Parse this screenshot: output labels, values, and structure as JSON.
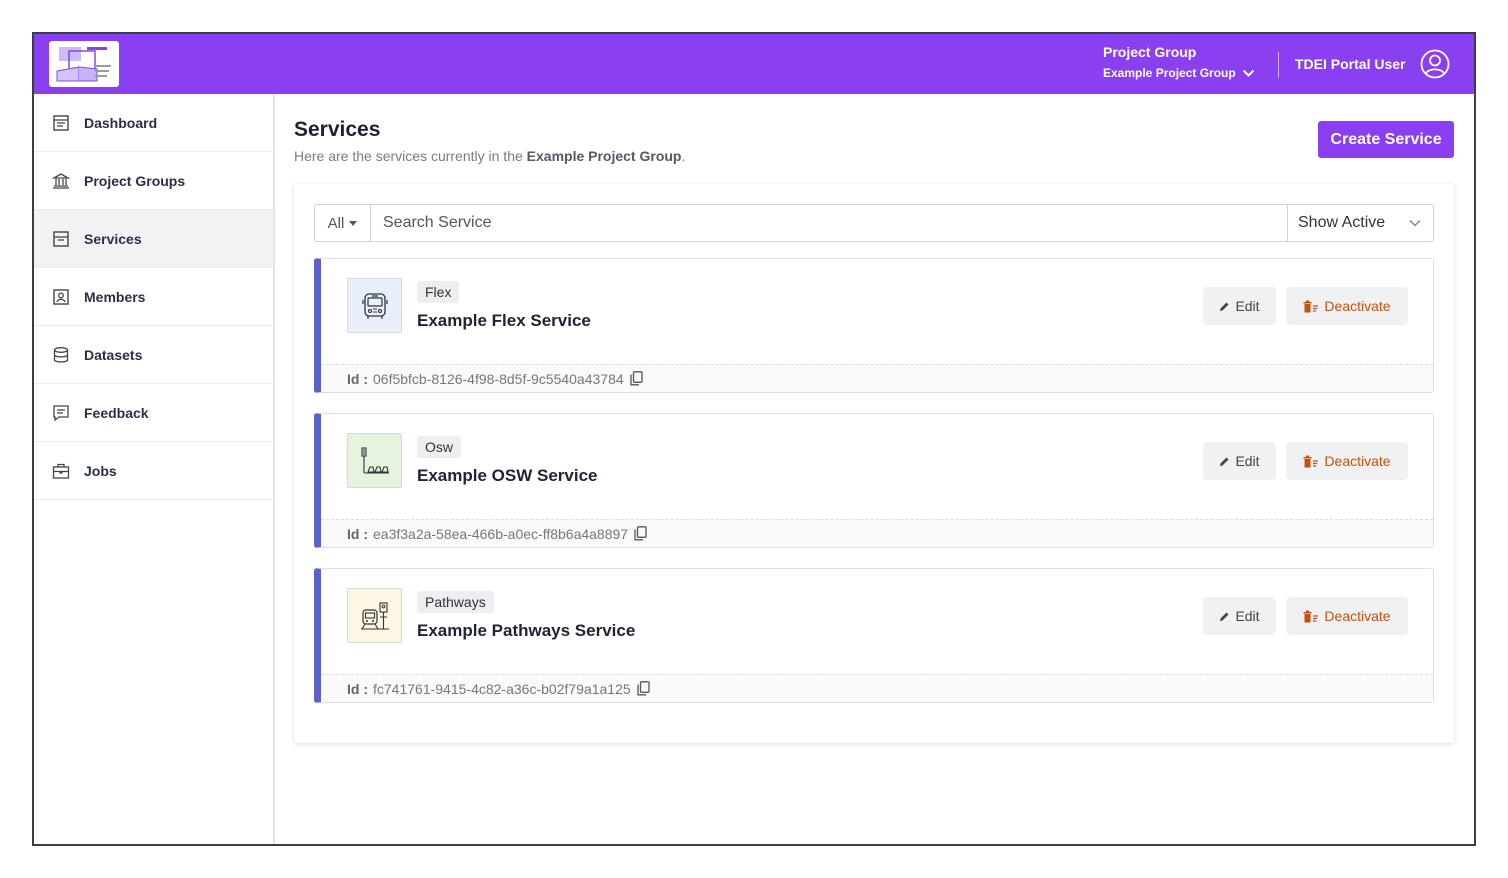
{
  "header": {
    "project_group_label": "Project Group",
    "project_group_value": "Example Project Group",
    "user_name": "TDEI Portal User"
  },
  "sidebar": {
    "items": [
      {
        "label": "Dashboard",
        "icon": "dashboard-icon"
      },
      {
        "label": "Project Groups",
        "icon": "bank-icon"
      },
      {
        "label": "Services",
        "icon": "archive-icon",
        "active": true
      },
      {
        "label": "Members",
        "icon": "member-badge-icon"
      },
      {
        "label": "Datasets",
        "icon": "database-icon"
      },
      {
        "label": "Feedback",
        "icon": "feedback-icon"
      },
      {
        "label": "Jobs",
        "icon": "briefcase-icon"
      }
    ]
  },
  "main": {
    "title": "Services",
    "subtitle_prefix": "Here are the services currently in the",
    "subtitle_group": "Example Project Group",
    "subtitle_suffix": ".",
    "create_label": "Create Service",
    "filter_all": "All",
    "search_placeholder": "Search Service",
    "status_filter": "Show Active",
    "edit_label": "Edit",
    "deactivate_label": "Deactivate",
    "id_label": "Id :",
    "services": [
      {
        "type": "Flex",
        "name": "Example Flex Service",
        "id": "06f5bfcb-8126-4f98-8d5f-9c5540a43784",
        "icon": "bus-icon",
        "icon_bg": "#e8f1fb"
      },
      {
        "type": "Osw",
        "name": "Example OSW Service",
        "id": "ea3f3a2a-58ea-466b-a0ec-ff8b6a4a8897",
        "icon": "sidewalk-icon",
        "icon_bg": "#e6f4df"
      },
      {
        "type": "Pathways",
        "name": "Example Pathways Service",
        "id": "fc741761-9415-4c82-a36c-b02f79a1a125",
        "icon": "train-station-icon",
        "icon_bg": "#fdf6e2"
      }
    ]
  },
  "colors": {
    "brand": "#8a3ff0",
    "card_accent": "#5b61c6",
    "deactivate": "#c5510e"
  }
}
